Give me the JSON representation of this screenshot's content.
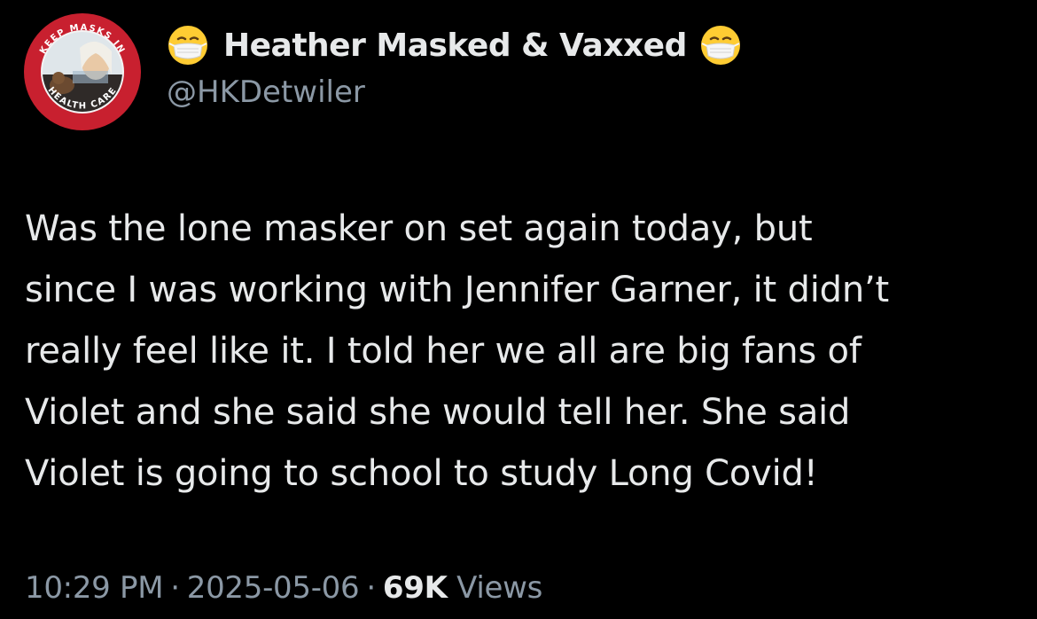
{
  "tweet": {
    "author": {
      "display_name": "Heather Masked & Vaxxed",
      "handle": "@HKDetwiler",
      "avatar_badge_text": "KEEP MASKS IN HEALTH CARE",
      "name_emoji": "face-with-medical-mask-icon"
    },
    "text_lines": [
      "Was the lone masker on set again today,  but",
      "since I was working with Jennifer Garner, it didn’t",
      "really feel like it. I told her we all are big fans of",
      "Violet and she said she would tell her. She said",
      "Violet is going to school to study Long Covid!"
    ],
    "meta": {
      "time": "10:29 PM",
      "separator": "·",
      "date": "2025-05-06",
      "views_count": "69K",
      "views_label": "Views"
    }
  },
  "colors": {
    "background": "#000000",
    "primary_text": "#e7e9ea",
    "secondary_text": "#8b98a5",
    "badge_red": "#c8202f"
  }
}
